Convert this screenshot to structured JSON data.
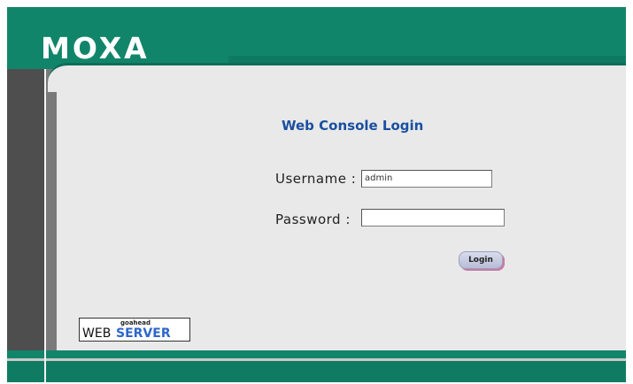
{
  "header": {
    "logo_text": "MOXA"
  },
  "login": {
    "title": "Web Console Login",
    "username_label": "Username :",
    "username_value": "admin",
    "password_label": "Password :",
    "password_value": "",
    "login_button": "Login"
  },
  "badge": {
    "small_text": "goahead",
    "web_text": "WEB",
    "server_text": "SERVER"
  },
  "colors": {
    "brand_green": "#11856a",
    "title_blue": "#1a4fa0",
    "sidebar_dark": "#4e4e4e",
    "content_bg": "#e9e9e9"
  }
}
